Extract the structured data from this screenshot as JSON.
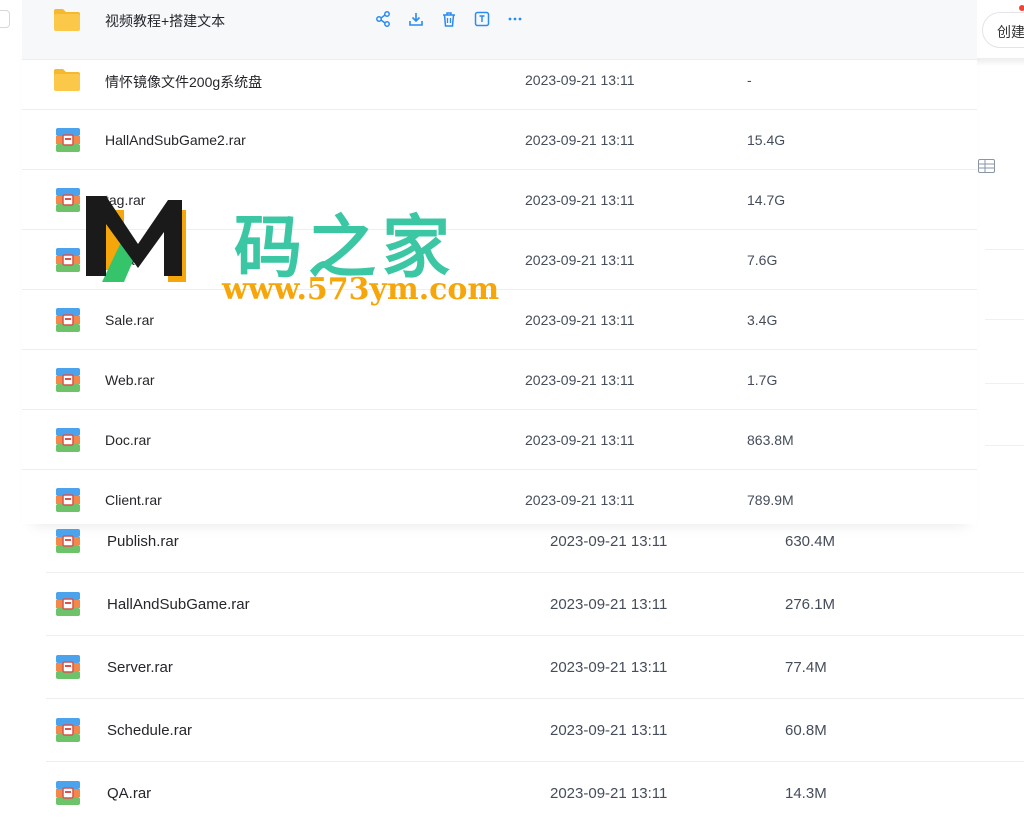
{
  "top_list": {
    "rows": [
      {
        "name": "视频教程+搭建文本",
        "date": "",
        "size": "",
        "icon": "folder-icon"
      },
      {
        "name": "情怀镜像文件200g系统盘",
        "date": "2023-09-21 13:11",
        "size": "-",
        "icon": "folder-icon"
      },
      {
        "name": "HallAndSubGame2.rar",
        "date": "2023-09-21 13:11",
        "size": "15.4G",
        "icon": "archive-icon"
      },
      {
        "name": "tag.rar",
        "date": "2023-09-21 13:11",
        "size": "14.7G",
        "icon": "archive-icon"
      },
      {
        "name": "R...a",
        "date": "2023-09-21 13:11",
        "size": "7.6G",
        "icon": "archive-icon"
      },
      {
        "name": "Sale.rar",
        "date": "2023-09-21 13:11",
        "size": "3.4G",
        "icon": "archive-icon"
      },
      {
        "name": "Web.rar",
        "date": "2023-09-21 13:11",
        "size": "1.7G",
        "icon": "archive-icon"
      },
      {
        "name": "Doc.rar",
        "date": "2023-09-21 13:11",
        "size": "863.8M",
        "icon": "archive-icon"
      },
      {
        "name": "Client.rar",
        "date": "2023-09-21 13:11",
        "size": "789.9M",
        "icon": "archive-icon"
      }
    ],
    "toolbar": [
      "share-icon",
      "download-icon",
      "delete-icon",
      "rename-icon",
      "more-icon"
    ]
  },
  "bottom_list": {
    "rows": [
      {
        "name": "Publish.rar",
        "date": "2023-09-21 13:11",
        "size": "630.4M"
      },
      {
        "name": "HallAndSubGame.rar",
        "date": "2023-09-21 13:11",
        "size": "276.1M"
      },
      {
        "name": "Server.rar",
        "date": "2023-09-21 13:11",
        "size": "77.4M"
      },
      {
        "name": "Schedule.rar",
        "date": "2023-09-21 13:11",
        "size": "60.8M"
      },
      {
        "name": "QA.rar",
        "date": "2023-09-21 13:11",
        "size": "14.3M"
      }
    ]
  },
  "right_panel": {
    "create_label": "创建",
    "view_icon": "grid-view-icon"
  },
  "watermark": {
    "cn": "码之家",
    "url": "www.573ym.com"
  },
  "colors": {
    "accent": "#2a8bf2",
    "folder": "#fcc43f",
    "watermark_green": "#3cc7a4",
    "watermark_orange": "#f5a60b"
  }
}
